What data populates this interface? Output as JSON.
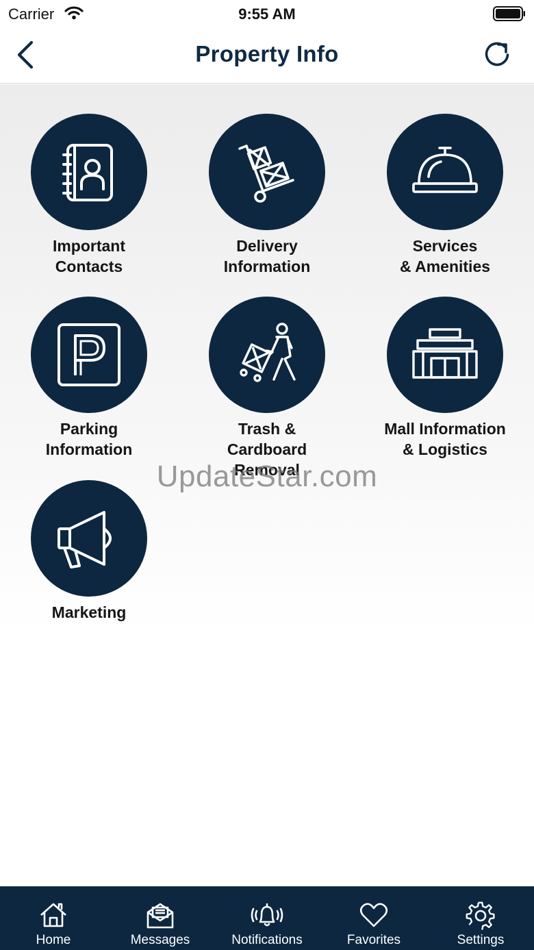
{
  "status_bar": {
    "carrier": "Carrier",
    "time": "9:55 AM"
  },
  "nav": {
    "title": "Property Info"
  },
  "tiles": [
    {
      "label": "Important\nContacts",
      "icon": "address-book-icon"
    },
    {
      "label": "Delivery\nInformation",
      "icon": "hand-truck-icon"
    },
    {
      "label": "Services\n& Amenities",
      "icon": "service-bell-icon"
    },
    {
      "label": "Parking\nInformation",
      "icon": "parking-icon"
    },
    {
      "label": "Trash &\nCardboard\nRemoval",
      "icon": "trash-cart-person-icon"
    },
    {
      "label": "Mall Information\n& Logistics",
      "icon": "mall-building-icon"
    },
    {
      "label": "Marketing",
      "icon": "megaphone-icon"
    }
  ],
  "watermark": "UpdateStar.com",
  "tab_bar": [
    {
      "label": "Home",
      "icon": "home-icon"
    },
    {
      "label": "Messages",
      "icon": "envelope-icon"
    },
    {
      "label": "Notifications",
      "icon": "bell-icon"
    },
    {
      "label": "Favorites",
      "icon": "heart-icon"
    },
    {
      "label": "Settings",
      "icon": "gear-icon"
    }
  ],
  "colors": {
    "navy": "#0d2740",
    "title": "#0f2a43",
    "background": "#ececec"
  }
}
